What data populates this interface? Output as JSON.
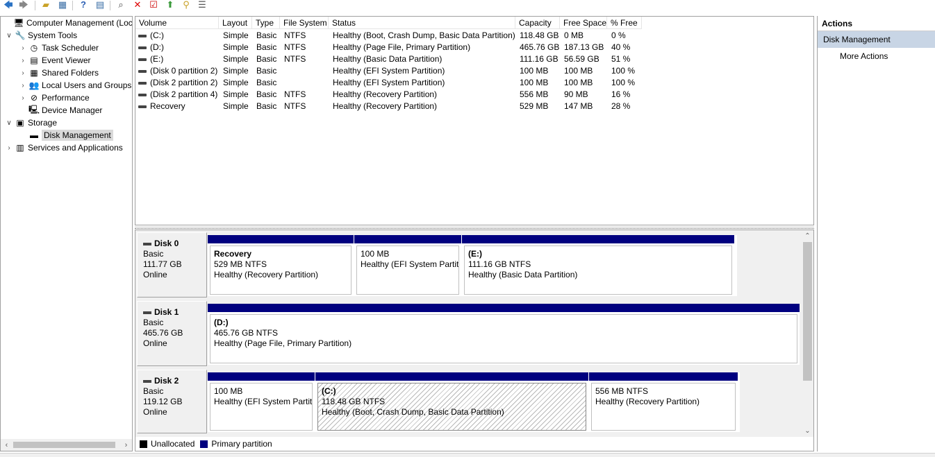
{
  "toolbar": {
    "icons": [
      "back-icon",
      "forward-icon",
      "up-folder-icon",
      "show-hide-tree-icon",
      "help-icon",
      "properties-icon",
      "connect-icon",
      "delete-icon",
      "check-icon",
      "arrow-up-icon",
      "search-icon",
      "list-icon"
    ]
  },
  "tree": {
    "items": [
      {
        "label": "Computer Management (Local",
        "chev": "",
        "icon": "🖥",
        "name": "tree-computer-management"
      },
      {
        "label": "System Tools",
        "chev": "∨",
        "icon": "🔧",
        "name": "tree-system-tools"
      },
      {
        "label": "Task Scheduler",
        "chev": "›",
        "icon": "◷",
        "name": "tree-task-scheduler"
      },
      {
        "label": "Event Viewer",
        "chev": "›",
        "icon": "▤",
        "name": "tree-event-viewer"
      },
      {
        "label": "Shared Folders",
        "chev": "›",
        "icon": "▦",
        "name": "tree-shared-folders"
      },
      {
        "label": "Local Users and Groups",
        "chev": "›",
        "icon": "👥",
        "name": "tree-local-users-groups"
      },
      {
        "label": "Performance",
        "chev": "›",
        "icon": "⊘",
        "name": "tree-performance"
      },
      {
        "label": "Device Manager",
        "chev": "",
        "icon": "🖳",
        "name": "tree-device-manager"
      },
      {
        "label": "Storage",
        "chev": "∨",
        "icon": "▣",
        "name": "tree-storage"
      },
      {
        "label": "Disk Management",
        "chev": "",
        "icon": "▬",
        "name": "tree-disk-management"
      },
      {
        "label": "Services and Applications",
        "chev": "›",
        "icon": "▥",
        "name": "tree-services-applications"
      }
    ]
  },
  "volumes": {
    "headers": [
      "Volume",
      "Layout",
      "Type",
      "File System",
      "Status",
      "Capacity",
      "Free Space",
      "% Free"
    ],
    "rows": [
      [
        "(C:)",
        "Simple",
        "Basic",
        "NTFS",
        "Healthy (Boot, Crash Dump, Basic Data Partition)",
        "118.48 GB",
        "0 MB",
        "0 %"
      ],
      [
        "(D:)",
        "Simple",
        "Basic",
        "NTFS",
        "Healthy (Page File, Primary Partition)",
        "465.76 GB",
        "187.13 GB",
        "40 %"
      ],
      [
        "(E:)",
        "Simple",
        "Basic",
        "NTFS",
        "Healthy (Basic Data Partition)",
        "111.16 GB",
        "56.59 GB",
        "51 %"
      ],
      [
        "(Disk 0 partition 2)",
        "Simple",
        "Basic",
        "",
        "Healthy (EFI System Partition)",
        "100 MB",
        "100 MB",
        "100 %"
      ],
      [
        "(Disk 2 partition 2)",
        "Simple",
        "Basic",
        "",
        "Healthy (EFI System Partition)",
        "100 MB",
        "100 MB",
        "100 %"
      ],
      [
        "(Disk 2 partition 4)",
        "Simple",
        "Basic",
        "NTFS",
        "Healthy (Recovery Partition)",
        "556 MB",
        "90 MB",
        "16 %"
      ],
      [
        "Recovery",
        "Simple",
        "Basic",
        "NTFS",
        "Healthy (Recovery Partition)",
        "529 MB",
        "147 MB",
        "28 %"
      ]
    ]
  },
  "disks": [
    {
      "name": "Disk 0",
      "type": "Basic",
      "size": "111.77 GB",
      "state": "Online",
      "partitions": [
        {
          "title": "Recovery",
          "line1": "529 MB NTFS",
          "line2": "Healthy (Recovery Partition)",
          "hatched": false
        },
        {
          "title": "",
          "line1": "100 MB",
          "line2": "Healthy (EFI System Partiti",
          "hatched": false
        },
        {
          "title": "(E:)",
          "line1": "111.16 GB NTFS",
          "line2": "Healthy (Basic Data Partition)",
          "hatched": false
        }
      ]
    },
    {
      "name": "Disk 1",
      "type": "Basic",
      "size": "465.76 GB",
      "state": "Online",
      "partitions": [
        {
          "title": "(D:)",
          "line1": "465.76 GB NTFS",
          "line2": "Healthy (Page File, Primary Partition)",
          "hatched": false
        }
      ]
    },
    {
      "name": "Disk 2",
      "type": "Basic",
      "size": "119.12 GB",
      "state": "Online",
      "partitions": [
        {
          "title": "",
          "line1": "100 MB",
          "line2": "Healthy (EFI System Partiti",
          "hatched": false
        },
        {
          "title": "(C:)",
          "line1": "118.48 GB NTFS",
          "line2": "Healthy (Boot, Crash Dump, Basic Data Partition)",
          "hatched": true
        },
        {
          "title": "",
          "line1": "556 MB NTFS",
          "line2": "Healthy (Recovery Partition)",
          "hatched": false
        }
      ]
    }
  ],
  "legend": {
    "unallocated": "Unallocated",
    "primary": "Primary partition",
    "unallocated_color": "#000000",
    "primary_color": "#00007f"
  },
  "actions": {
    "header": "Actions",
    "section": "Disk Management",
    "items": [
      "More Actions"
    ]
  }
}
